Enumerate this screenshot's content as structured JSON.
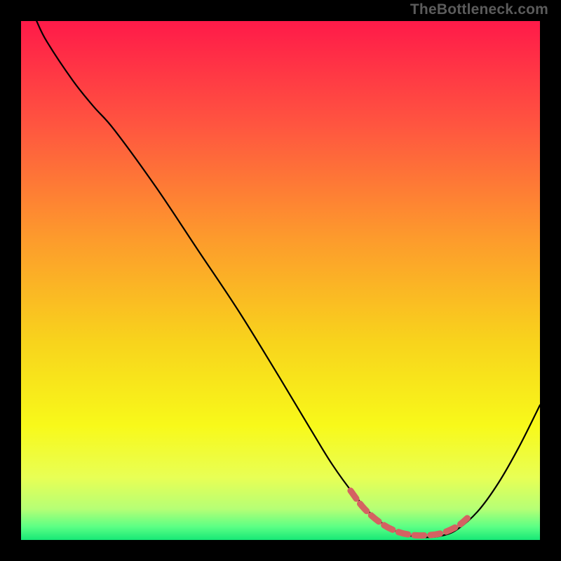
{
  "watermark": "TheBottleneck.com",
  "chart_data": {
    "type": "line",
    "title": "",
    "xlabel": "",
    "ylabel": "",
    "xlim": [
      0,
      100
    ],
    "ylim": [
      0,
      100
    ],
    "grid": false,
    "legend": false,
    "background_gradient_stops": [
      {
        "offset": 0.0,
        "color": "#ff1a49"
      },
      {
        "offset": 0.2,
        "color": "#ff5540"
      },
      {
        "offset": 0.42,
        "color": "#fd9b2c"
      },
      {
        "offset": 0.62,
        "color": "#f8d41c"
      },
      {
        "offset": 0.78,
        "color": "#f8f91a"
      },
      {
        "offset": 0.88,
        "color": "#e8ff55"
      },
      {
        "offset": 0.94,
        "color": "#b6ff75"
      },
      {
        "offset": 0.975,
        "color": "#5aff85"
      },
      {
        "offset": 1.0,
        "color": "#17e876"
      }
    ],
    "series": [
      {
        "name": "bottleneck-curve",
        "stroke": "#000000",
        "stroke_width": 2.2,
        "points": [
          {
            "x": 3.0,
            "y": 100.0
          },
          {
            "x": 5.0,
            "y": 96.0
          },
          {
            "x": 10.0,
            "y": 88.5
          },
          {
            "x": 14.0,
            "y": 83.5
          },
          {
            "x": 18.0,
            "y": 79.0
          },
          {
            "x": 26.0,
            "y": 68.0
          },
          {
            "x": 34.0,
            "y": 56.0
          },
          {
            "x": 42.0,
            "y": 44.0
          },
          {
            "x": 50.0,
            "y": 31.0
          },
          {
            "x": 56.0,
            "y": 21.0
          },
          {
            "x": 60.0,
            "y": 14.5
          },
          {
            "x": 64.0,
            "y": 9.0
          },
          {
            "x": 68.0,
            "y": 4.5
          },
          {
            "x": 72.0,
            "y": 1.8
          },
          {
            "x": 75.0,
            "y": 0.8
          },
          {
            "x": 78.0,
            "y": 0.5
          },
          {
            "x": 81.0,
            "y": 0.8
          },
          {
            "x": 84.0,
            "y": 2.0
          },
          {
            "x": 88.0,
            "y": 5.5
          },
          {
            "x": 92.0,
            "y": 11.0
          },
          {
            "x": 96.0,
            "y": 18.0
          },
          {
            "x": 100.0,
            "y": 26.0
          }
        ]
      },
      {
        "name": "optimal-band",
        "stroke": "#d46262",
        "stroke_width": 9,
        "dash": [
          14,
          9
        ],
        "linecap": "round",
        "points": [
          {
            "x": 63.5,
            "y": 9.5
          },
          {
            "x": 66.0,
            "y": 6.2
          },
          {
            "x": 69.0,
            "y": 3.5
          },
          {
            "x": 72.0,
            "y": 1.8
          },
          {
            "x": 75.0,
            "y": 1.0
          },
          {
            "x": 78.0,
            "y": 0.9
          },
          {
            "x": 81.0,
            "y": 1.3
          },
          {
            "x": 84.0,
            "y": 2.6
          },
          {
            "x": 86.0,
            "y": 4.2
          }
        ]
      }
    ]
  }
}
